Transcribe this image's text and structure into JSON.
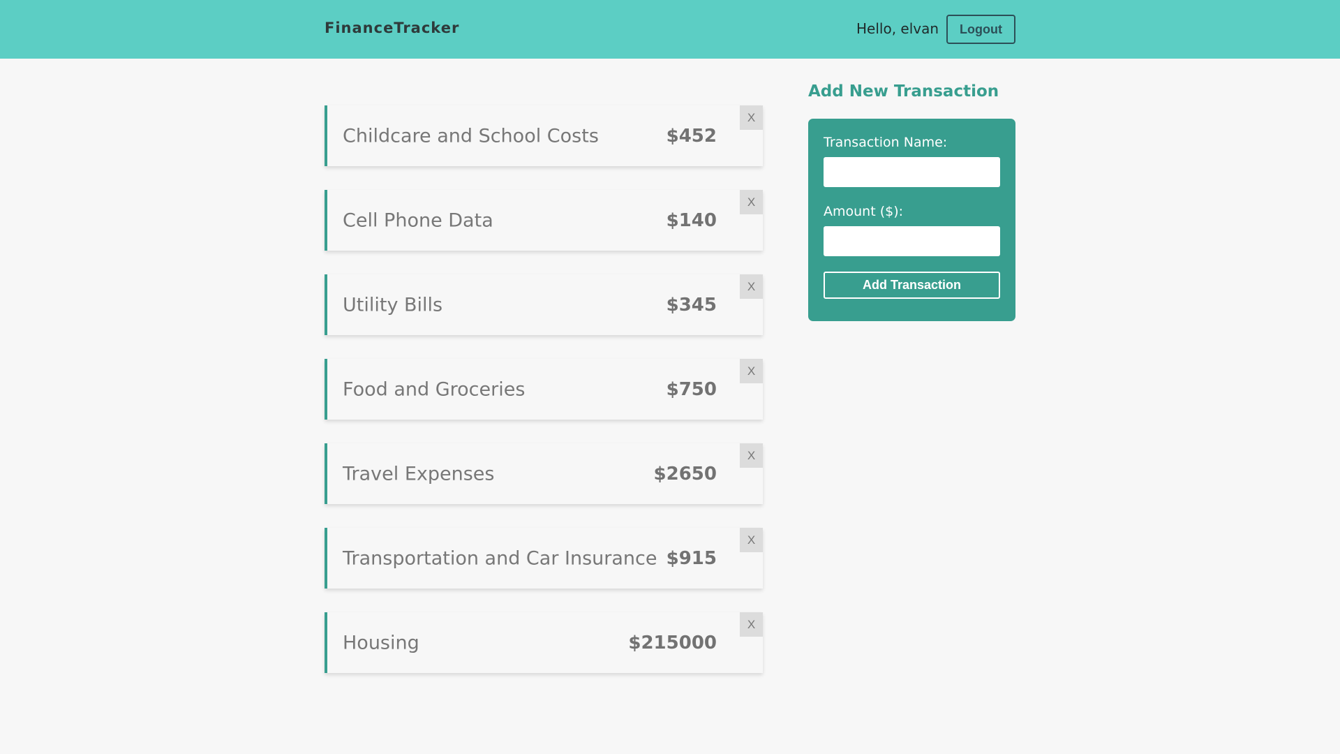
{
  "header": {
    "brand": "FinanceTracker",
    "greeting": "Hello, elvan",
    "logout_label": "Logout"
  },
  "transactions": [
    {
      "name": "Childcare and School Costs",
      "amount": "$452",
      "delete_label": "X"
    },
    {
      "name": "Cell Phone Data",
      "amount": "$140",
      "delete_label": "X"
    },
    {
      "name": "Utility Bills",
      "amount": "$345",
      "delete_label": "X"
    },
    {
      "name": "Food and Groceries",
      "amount": "$750",
      "delete_label": "X"
    },
    {
      "name": "Travel Expenses",
      "amount": "$2650",
      "delete_label": "X"
    },
    {
      "name": "Transportation and Car Insurance",
      "amount": "$915",
      "delete_label": "X"
    },
    {
      "name": "Housing",
      "amount": "$215000",
      "delete_label": "X"
    }
  ],
  "form": {
    "title": "Add New Transaction",
    "name_label": "Transaction Name:",
    "name_value": "",
    "amount_label": "Amount ($):",
    "amount_value": "",
    "submit_label": "Add Transaction"
  },
  "colors": {
    "header": "#5ccec4",
    "accent": "#389e8f",
    "background": "#f7f7f7"
  }
}
